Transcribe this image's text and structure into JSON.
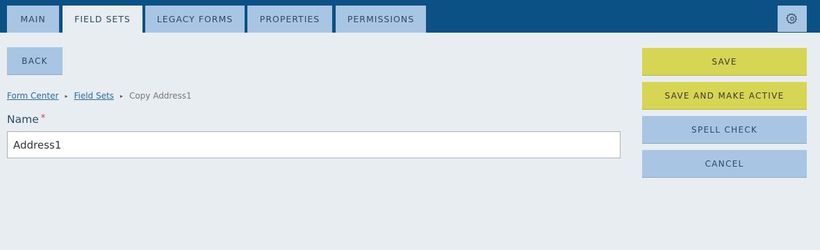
{
  "tabs": [
    {
      "label": "MAIN"
    },
    {
      "label": "FIELD SETS",
      "active": true
    },
    {
      "label": "LEGACY FORMS"
    },
    {
      "label": "PROPERTIES"
    },
    {
      "label": "PERMISSIONS"
    }
  ],
  "settings_icon": "gear-icon",
  "back_label": "BACK",
  "breadcrumb": {
    "items": [
      "Form Center",
      "Field Sets"
    ],
    "current": "Copy Address1",
    "separator": "▸"
  },
  "form": {
    "name_label": "Name",
    "required_marker": "*",
    "name_value": "Address1"
  },
  "actions": {
    "save": "SAVE",
    "save_active": "SAVE AND MAKE ACTIVE",
    "spell_check": "SPELL CHECK",
    "cancel": "CANCEL"
  },
  "colors": {
    "header_bg": "#0b5185",
    "tab_bg": "#a8c5e4",
    "page_bg": "#e8edf2",
    "save_button": "#d6d654"
  }
}
